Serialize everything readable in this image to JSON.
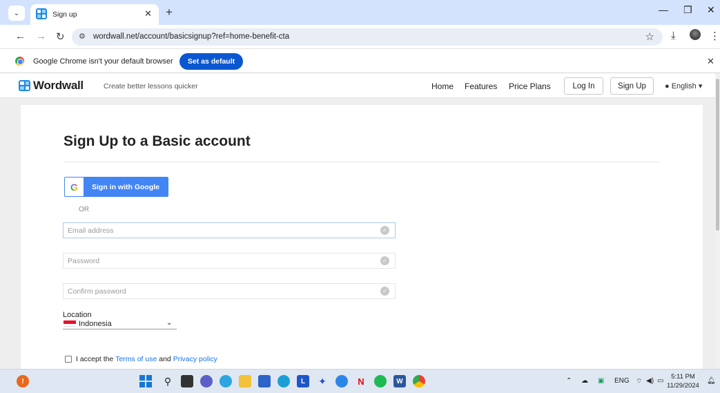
{
  "browser": {
    "tab_title": "Sign up",
    "url": "wordwall.net/account/basicsignup?ref=home-benefit-cta",
    "infobar_message": "Google Chrome isn't your default browser",
    "infobar_button": "Set as default"
  },
  "site": {
    "brand": "Wordwall",
    "tagline": "Create better lessons quicker",
    "nav": {
      "home": "Home",
      "features": "Features",
      "price_plans": "Price Plans"
    },
    "login": "Log In",
    "signup": "Sign Up",
    "language": "English"
  },
  "form": {
    "heading": "Sign Up to a Basic account",
    "google_button": "Sign in with Google",
    "or": "OR",
    "email_placeholder": "Email address",
    "password_placeholder": "Password",
    "confirm_placeholder": "Confirm password",
    "location_label": "Location",
    "location_value": "Indonesia",
    "terms": {
      "prefix": "I accept the",
      "terms_link": "Terms of use",
      "and": "and",
      "privacy_link": "Privacy policy"
    }
  },
  "taskbar": {
    "language": "ENG",
    "time": "5:11 PM",
    "date": "11/29/2024"
  },
  "icons": [
    "chevron-down-icon",
    "close-icon",
    "plus-icon",
    "back-icon",
    "forward-icon",
    "reload-icon",
    "site-settings-icon",
    "star-icon",
    "download-icon",
    "kebab-icon",
    "globe-icon",
    "check-icon",
    "windows-icon",
    "search-icon",
    "bell-icon"
  ],
  "colors": {
    "tabstrip": "#d3e3fd",
    "chrome_blue": "#0b57d0",
    "google_blue": "#4285f4",
    "link_blue": "#1a73e8",
    "wordwall_blue": "#1e88e5",
    "page_bg": "#eeeeee",
    "taskbar": "#dfe7f2"
  }
}
